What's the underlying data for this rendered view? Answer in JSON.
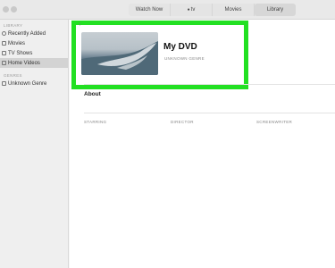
{
  "window": {
    "tabs": [
      {
        "label": "Watch Now",
        "active": false
      },
      {
        "label": "tv",
        "brand_icon": "apple-logo-icon",
        "active": false
      },
      {
        "label": "Movies",
        "active": false
      },
      {
        "label": "Library",
        "active": true
      }
    ]
  },
  "sidebar": {
    "section_library": "LIBRARY",
    "items": [
      {
        "label": "Recently Added",
        "icon": "clock-icon"
      },
      {
        "label": "Movies",
        "icon": "film-icon"
      },
      {
        "label": "TV Shows",
        "icon": "tv-icon"
      },
      {
        "label": "Home Videos",
        "icon": "camera-icon",
        "selected": true
      }
    ],
    "section_genres": "GENRES",
    "genres": [
      {
        "label": "Unknown Genre",
        "icon": "genre-icon"
      }
    ]
  },
  "detail": {
    "back_glyph": "‹",
    "title": "My DVD",
    "genre": "UNKNOWN GENRE",
    "about_heading": "About",
    "credits": {
      "starring": "STARRING",
      "director": "DIRECTOR",
      "screenwriter": "SCREENWRITER"
    }
  },
  "colors": {
    "highlight": "#22e022",
    "selected_sidebar": "#d3d3d3"
  }
}
